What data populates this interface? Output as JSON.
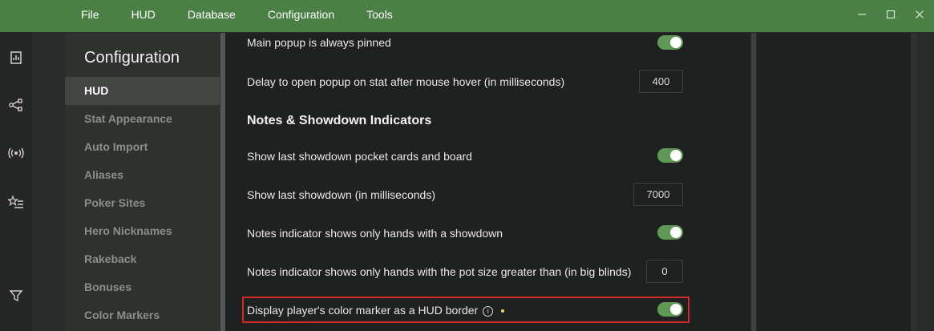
{
  "menu": {
    "items": [
      "File",
      "HUD",
      "Database",
      "Configuration",
      "Tools"
    ]
  },
  "window": {
    "minimize_icon": "minimize-icon",
    "maximize_icon": "maximize-icon",
    "close_icon": "close-icon"
  },
  "leftbar": {
    "icons": [
      "app-logo-icon",
      "report-icon",
      "share-network-icon",
      "broadcast-icon",
      "star-list-icon",
      "filter-icon"
    ]
  },
  "config": {
    "title": "Configuration",
    "nav": [
      "HUD",
      "Stat Appearance",
      "Auto Import",
      "Aliases",
      "Poker Sites",
      "Hero Nicknames",
      "Rakeback",
      "Bonuses",
      "Color Markers"
    ],
    "active": "HUD"
  },
  "settings": {
    "popup_pinned": "Main popup is always pinned",
    "delay_label": "Delay to open popup on stat after mouse hover (in milliseconds)",
    "delay_value": "400",
    "section_title": "Notes & Showdown Indicators",
    "show_showdown_cards": "Show last showdown pocket cards and board",
    "show_showdown_ms_label": "Show last showdown (in milliseconds)",
    "show_showdown_ms_value": "7000",
    "notes_showdown_only": "Notes indicator shows only hands with a showdown",
    "notes_pot_size_label": "Notes indicator shows only hands with the pot size greater than (in big blinds)",
    "notes_pot_size_value": "0",
    "color_marker_border": "Display player's color marker as a HUD border"
  },
  "colors": {
    "accent": "#4a8046",
    "toggle_on": "#5e9a55",
    "highlight": "#d12a2a",
    "dot": "#e7e05a"
  }
}
